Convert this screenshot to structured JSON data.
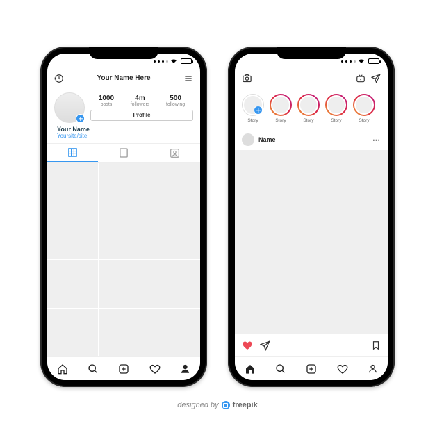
{
  "profile": {
    "title": "Your Name Here",
    "stats": {
      "posts": {
        "value": "1000",
        "label": "posts"
      },
      "followers": {
        "value": "4m",
        "label": "followers"
      },
      "following": {
        "value": "500",
        "label": "following"
      }
    },
    "profile_button": "Profile",
    "name": "Your Name",
    "site": "Yoursite/site",
    "grid_cells": 12
  },
  "feed": {
    "stories": [
      {
        "label": "Story",
        "own": true
      },
      {
        "label": "Story",
        "own": false
      },
      {
        "label": "Story",
        "own": false
      },
      {
        "label": "Story",
        "own": false
      },
      {
        "label": "Story",
        "own": false
      }
    ],
    "post": {
      "author": "Name",
      "liked": true
    }
  },
  "credit": {
    "prefix": "designed by",
    "brand": "freepik"
  }
}
